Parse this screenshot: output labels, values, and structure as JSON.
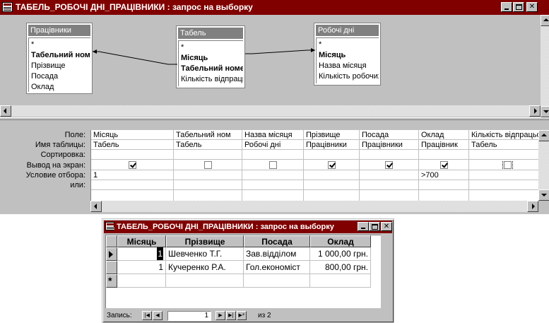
{
  "main_window": {
    "title": "ТАБЕЛЬ_РОБОЧІ ДНІ_ПРАЦІВНИКИ : запрос на выборку"
  },
  "tables": [
    {
      "title": "Працівники",
      "fields": [
        "*",
        "Табельний номер",
        "Прізвище",
        "Посада",
        "Оклад"
      ],
      "key_index": 1
    },
    {
      "title": "Табель",
      "fields": [
        "*",
        "Місяць",
        "Табельний номер",
        "Кількість відпрацьованих днів"
      ],
      "key_index": [
        1,
        2
      ]
    },
    {
      "title": "Робочі дні",
      "fields": [
        "*",
        "Місяць",
        "Назва місяця",
        "Кількість робочих днів"
      ],
      "key_index": 1
    }
  ],
  "qbe": {
    "row_labels": [
      "Поле:",
      "Имя таблицы:",
      "Сортировка:",
      "Вывод на экран:",
      "Условие отбора:",
      "или:"
    ],
    "columns": [
      {
        "field": "Місяць",
        "table": "Табель",
        "sort": "",
        "show": true,
        "criteria": "1",
        "or": ""
      },
      {
        "field": "Табельний ном",
        "table": "Табель",
        "sort": "",
        "show": false,
        "criteria": "",
        "or": ""
      },
      {
        "field": "Назва місяця",
        "table": "Робочі дні",
        "sort": "",
        "show": false,
        "criteria": "",
        "or": ""
      },
      {
        "field": "Прізвище",
        "table": "Працівники",
        "sort": "",
        "show": true,
        "criteria": "",
        "or": ""
      },
      {
        "field": "Посада",
        "table": "Працівники",
        "sort": "",
        "show": true,
        "criteria": "",
        "or": ""
      },
      {
        "field": "Оклад",
        "table": "Працівник",
        "sort": "",
        "show": true,
        "criteria": ">700",
        "or": ""
      },
      {
        "field": "Кількість відпрацьо",
        "table": "Табель",
        "sort": "",
        "show": false,
        "criteria": "",
        "or": ""
      }
    ]
  },
  "result_window": {
    "title": "ТАБЕЛЬ_РОБОЧІ ДНІ_ПРАЦІВНИКИ : запрос на выборку",
    "headers": [
      "Місяць",
      "Прізвище",
      "Посада",
      "Оклад"
    ],
    "rows": [
      {
        "month": "1",
        "surname": "Шевченко Т.Г.",
        "position": "Зав.відділом",
        "salary": "1 000,00 грн."
      },
      {
        "month": "1",
        "surname": "Кучеренко Р.А.",
        "position": "Гол.економіст",
        "salary": "800,00 грн."
      }
    ],
    "new_row_marker": "*",
    "nav": {
      "label": "Запись:",
      "current": "1",
      "total": "из 2"
    }
  }
}
